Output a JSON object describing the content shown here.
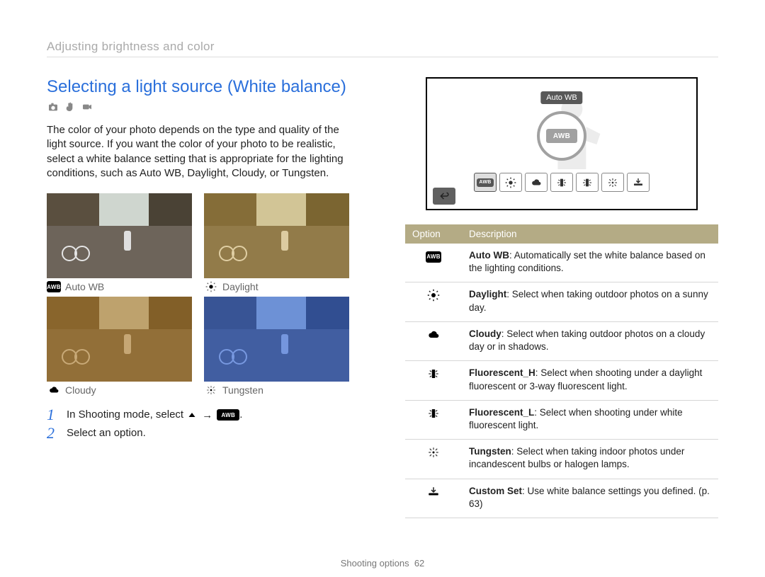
{
  "breadcrumb": "Adjusting brightness and color",
  "section_title": "Selecting a light source (White balance)",
  "intro_paragraph": "The color of your photo depends on the type and quality of the light source. If you want the color of your photo to be realistic, select a white balance setting that is appropriate for the lighting conditions, such as Auto WB, Daylight, Cloudy, or Tungsten.",
  "samples": [
    {
      "label": "Auto WB",
      "icon": "awb",
      "tint": "rgba(0,0,0,0)"
    },
    {
      "label": "Daylight",
      "icon": "daylight",
      "tint": "rgba(214,167,44,0.35)"
    },
    {
      "label": "Cloudy",
      "icon": "cloudy",
      "tint": "rgba(176,121,30,0.55)"
    },
    {
      "label": "Tungsten",
      "icon": "tungsten",
      "tint": "rgba(30,90,220,0.55)"
    }
  ],
  "steps": {
    "s1_pre": "In Shooting mode, select ",
    "s1_arrow": "→",
    "s1_post": ".",
    "s2": "Select an option."
  },
  "screen": {
    "tooltip": "Auto WB",
    "awb_text": "AWB"
  },
  "table": {
    "header_option": "Option",
    "header_desc": "Description",
    "rows": [
      {
        "icon": "awb",
        "title": "Auto WB",
        "desc": ": Automatically set the white balance based on the lighting conditions."
      },
      {
        "icon": "daylight",
        "title": "Daylight",
        "desc": ": Select when taking outdoor photos on a sunny day."
      },
      {
        "icon": "cloudy",
        "title": "Cloudy",
        "desc": ": Select when taking outdoor photos on a cloudy day or in shadows."
      },
      {
        "icon": "fluor_h",
        "title": "Fluorescent_H",
        "desc": ": Select when shooting under a daylight fluorescent or 3-way fluorescent light."
      },
      {
        "icon": "fluor_l",
        "title": "Fluorescent_L",
        "desc": ": Select when shooting under white fluorescent light."
      },
      {
        "icon": "tungsten",
        "title": "Tungsten",
        "desc": ": Select when taking indoor photos under incandescent bulbs or halogen lamps."
      },
      {
        "icon": "custom",
        "title": "Custom Set",
        "desc": ": Use white balance settings you defined. (p. 63)"
      }
    ]
  },
  "footer_section": "Shooting options",
  "footer_page": "62",
  "awb_chip_text": "AWB"
}
